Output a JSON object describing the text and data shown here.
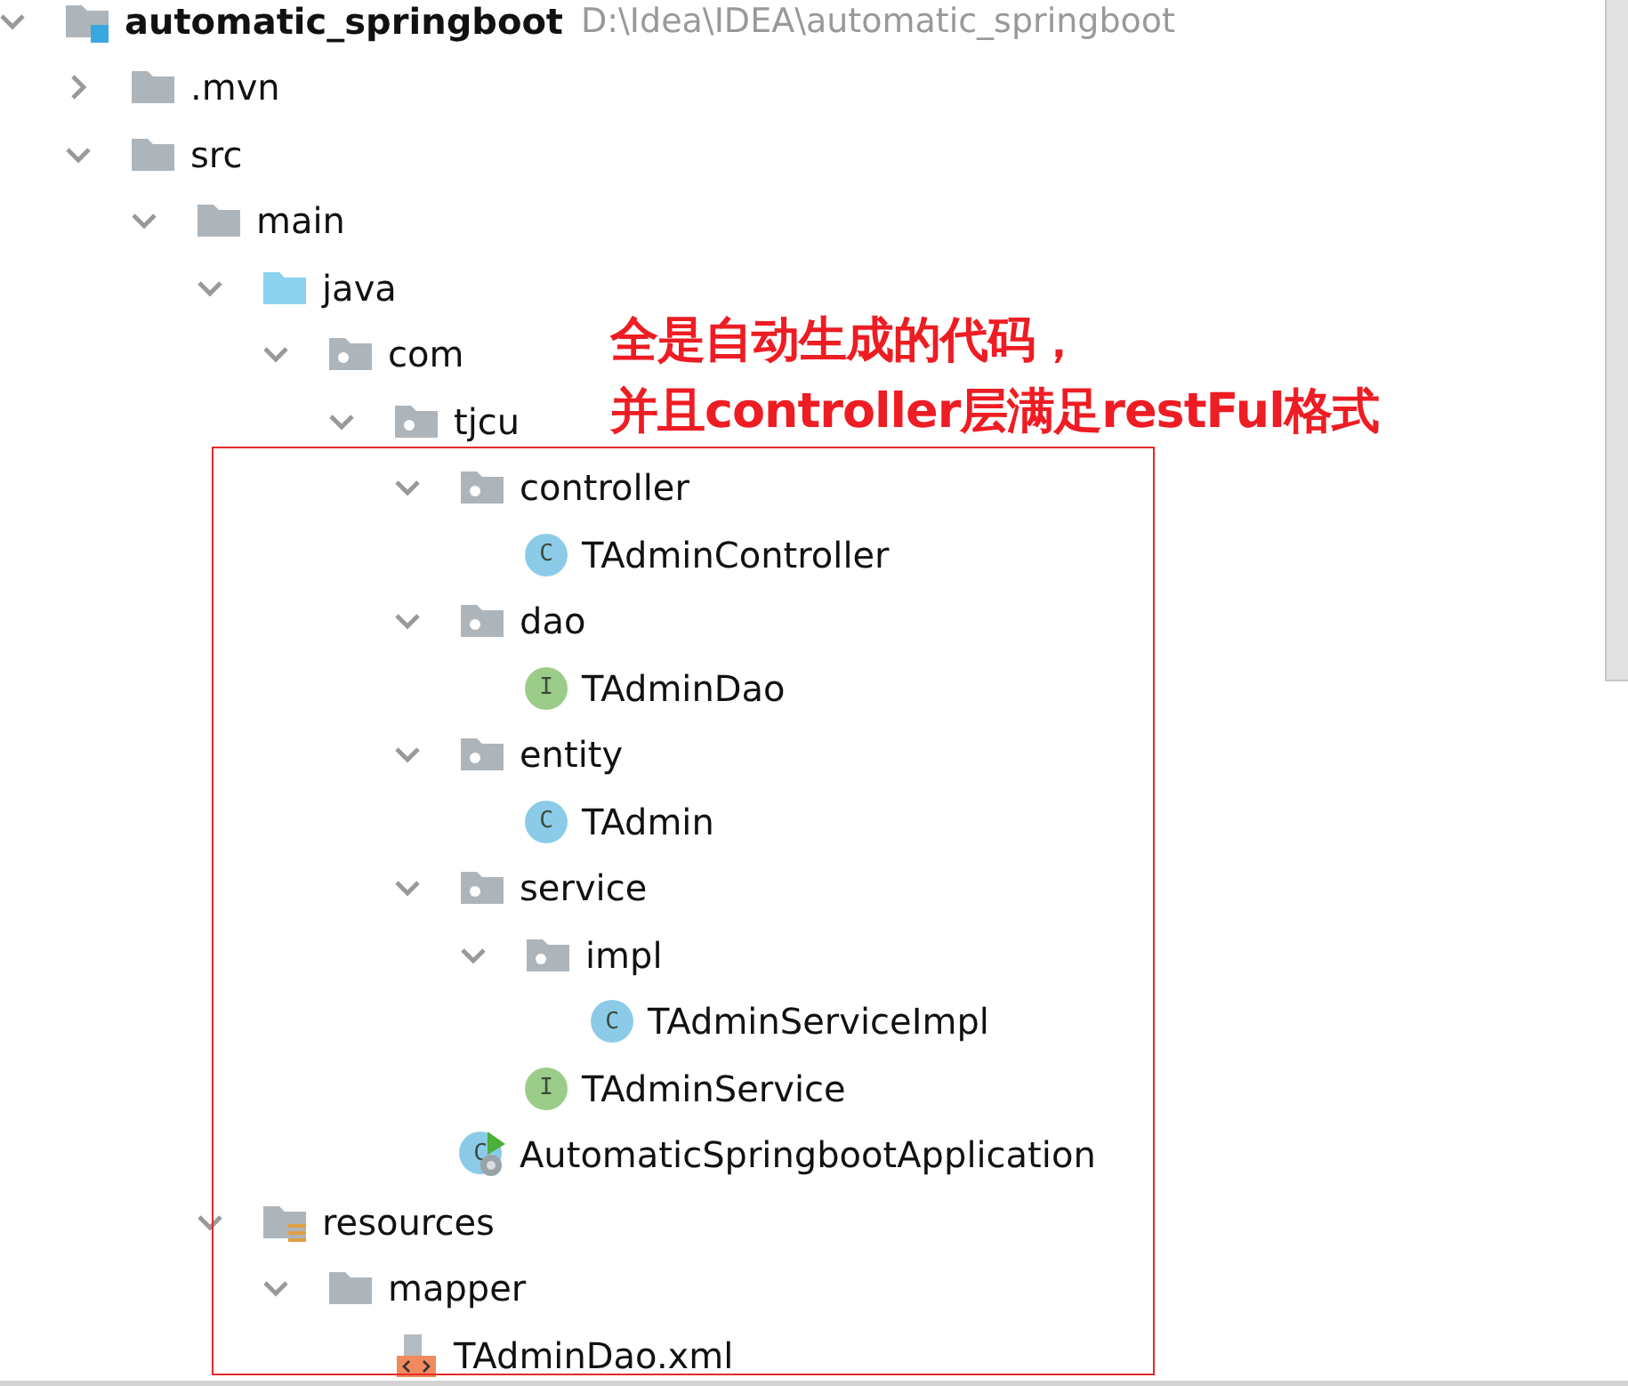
{
  "tree": [
    {
      "label": "automatic_springboot",
      "path": "D:\\Idea\\IDEA\\automatic_springboot",
      "kind": "module",
      "expanded": true,
      "children": [
        {
          "label": ".mvn",
          "kind": "folder",
          "expanded": false
        },
        {
          "label": "src",
          "kind": "folder",
          "expanded": true,
          "children": [
            {
              "label": "main",
              "kind": "folder",
              "expanded": true,
              "children": [
                {
                  "label": "java",
                  "kind": "source",
                  "expanded": true,
                  "children": [
                    {
                      "label": "com",
                      "kind": "package",
                      "expanded": true,
                      "children": [
                        {
                          "label": "tjcu",
                          "kind": "package",
                          "expanded": true,
                          "children": [
                            {
                              "label": "controller",
                              "kind": "package",
                              "expanded": true,
                              "children": [
                                {
                                  "label": "TAdminController",
                                  "kind": "class",
                                  "letter": "C"
                                }
                              ]
                            },
                            {
                              "label": "dao",
                              "kind": "package",
                              "expanded": true,
                              "children": [
                                {
                                  "label": "TAdminDao",
                                  "kind": "interface",
                                  "letter": "I"
                                }
                              ]
                            },
                            {
                              "label": "entity",
                              "kind": "package",
                              "expanded": true,
                              "children": [
                                {
                                  "label": "TAdmin",
                                  "kind": "class",
                                  "letter": "C"
                                }
                              ]
                            },
                            {
                              "label": "service",
                              "kind": "package",
                              "expanded": true,
                              "children": [
                                {
                                  "label": "impl",
                                  "kind": "package",
                                  "expanded": true,
                                  "children": [
                                    {
                                      "label": "TAdminServiceImpl",
                                      "kind": "class",
                                      "letter": "C"
                                    }
                                  ]
                                },
                                {
                                  "label": "TAdminService",
                                  "kind": "interface",
                                  "letter": "I"
                                }
                              ]
                            },
                            {
                              "label": "AutomaticSpringbootApplication",
                              "kind": "app",
                              "letter": "C"
                            }
                          ]
                        }
                      ]
                    }
                  ]
                },
                {
                  "label": "resources",
                  "kind": "resources",
                  "expanded": true,
                  "children": [
                    {
                      "label": "mapper",
                      "kind": "folder",
                      "expanded": true,
                      "children": [
                        {
                          "label": "TAdminDao.xml",
                          "kind": "xml"
                        }
                      ]
                    }
                  ]
                }
              ]
            }
          ]
        }
      ]
    }
  ],
  "annotation": {
    "lines": [
      "全是自动生成的代码，",
      "并且controller层满足restFul格式"
    ]
  }
}
